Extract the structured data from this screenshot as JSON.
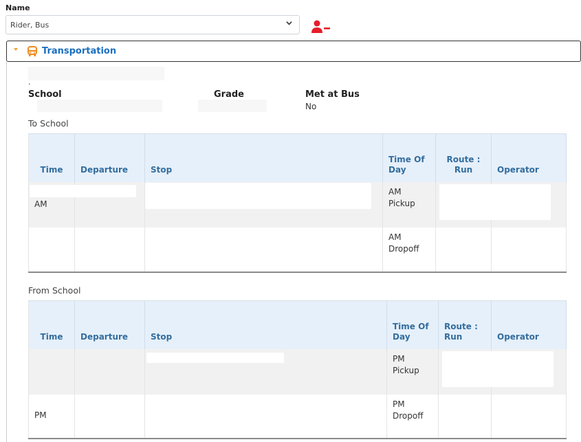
{
  "name_field": {
    "label": "Name",
    "selected": "Rider, Bus"
  },
  "panel": {
    "title": "Transportation"
  },
  "info": {
    "school_label": "School",
    "grade_label": "Grade",
    "met_label": "Met at Bus",
    "met_value": "No"
  },
  "to_school": {
    "label": "To School",
    "headers": [
      "Time",
      "Departure",
      "Stop",
      "Time Of Day",
      "Route : Run",
      "Operator"
    ],
    "rows": [
      {
        "time": "AM",
        "time_of_day": "AM Pickup"
      },
      {
        "time": "",
        "time_of_day": "AM Dropoff"
      }
    ]
  },
  "from_school": {
    "label": "From School",
    "headers": [
      "Time",
      "Departure",
      "Stop",
      "Time Of Day",
      "Route : Run",
      "Operator"
    ],
    "rows": [
      {
        "time": "",
        "time_of_day": "PM Pickup"
      },
      {
        "time": "PM",
        "time_of_day": "PM Dropoff"
      }
    ]
  },
  "colors": {
    "accent_blue": "#1a6fc0",
    "header_bg": "#e6f0fa",
    "remove_icon": "#e41e2b",
    "bus_icon": "#f08a1c"
  },
  "icons": [
    "chevron-down-icon",
    "remove-user-icon",
    "bus-icon"
  ]
}
